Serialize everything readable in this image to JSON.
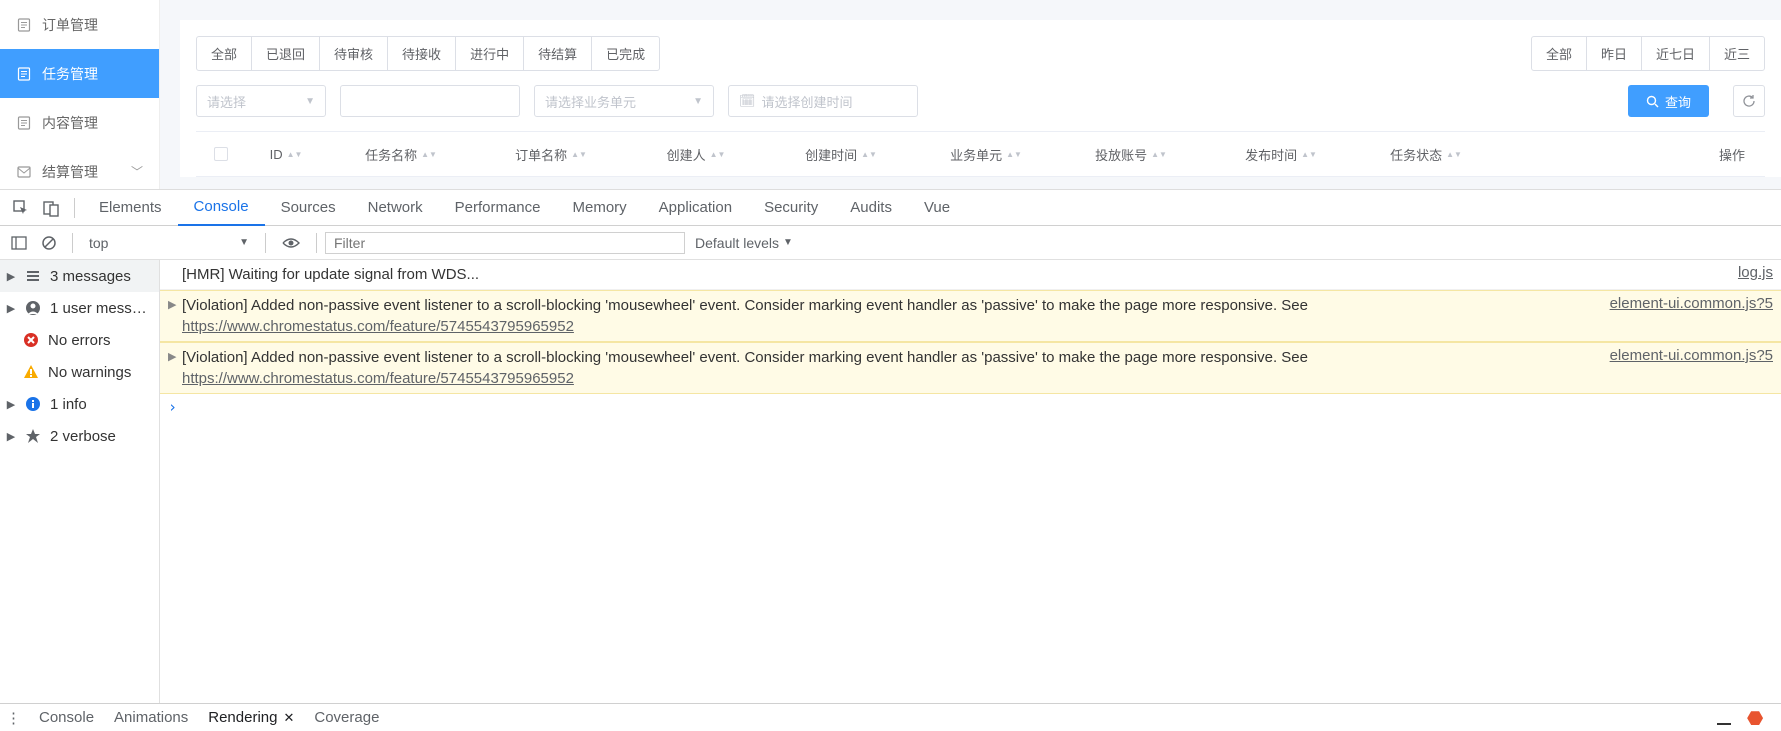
{
  "sidebar": {
    "items": [
      {
        "label": "订单管理"
      },
      {
        "label": "任务管理"
      },
      {
        "label": "内容管理"
      },
      {
        "label": "结算管理"
      }
    ]
  },
  "status_tabs": [
    "全部",
    "已退回",
    "待审核",
    "待接收",
    "进行中",
    "待结算",
    "已完成"
  ],
  "date_tabs": [
    "全部",
    "昨日",
    "近七日",
    "近三"
  ],
  "filters": {
    "select1_placeholder": "请选择",
    "select2_placeholder": "请选择业务单元",
    "date_placeholder": "请选择创建时间",
    "search_label": "查询"
  },
  "columns": [
    "ID",
    "任务名称",
    "订单名称",
    "创建人",
    "创建时间",
    "业务单元",
    "投放账号",
    "发布时间",
    "任务状态",
    "操作"
  ],
  "devtools": {
    "tabs": [
      "Elements",
      "Console",
      "Sources",
      "Network",
      "Performance",
      "Memory",
      "Application",
      "Security",
      "Audits",
      "Vue"
    ],
    "active_tab": "Console",
    "context": "top",
    "filter_placeholder": "Filter",
    "levels": "Default levels",
    "side": {
      "total": "3 messages",
      "user": "1 user mess…",
      "errors": "No errors",
      "warnings": "No warnings",
      "info": "1 info",
      "verbose": "2 verbose"
    },
    "msgs": [
      {
        "type": "log",
        "text": "[HMR] Waiting for update signal from WDS...",
        "src": "log.js"
      },
      {
        "type": "violation",
        "text": "[Violation] Added non-passive event listener to a scroll-blocking 'mousewheel' event. Consider marking event handler as 'passive' to make the page more responsive. See ",
        "link": "https://www.chromestatus.com/feature/5745543795965952",
        "src": "element-ui.common.js?5"
      },
      {
        "type": "violation",
        "text": "[Violation] Added non-passive event listener to a scroll-blocking 'mousewheel' event. Consider marking event handler as 'passive' to make the page more responsive. See ",
        "link": "https://www.chromestatus.com/feature/5745543795965952",
        "src": "element-ui.common.js?5"
      }
    ],
    "drawer": [
      "Console",
      "Animations",
      "Rendering",
      "Coverage"
    ],
    "drawer_active": "Rendering"
  }
}
